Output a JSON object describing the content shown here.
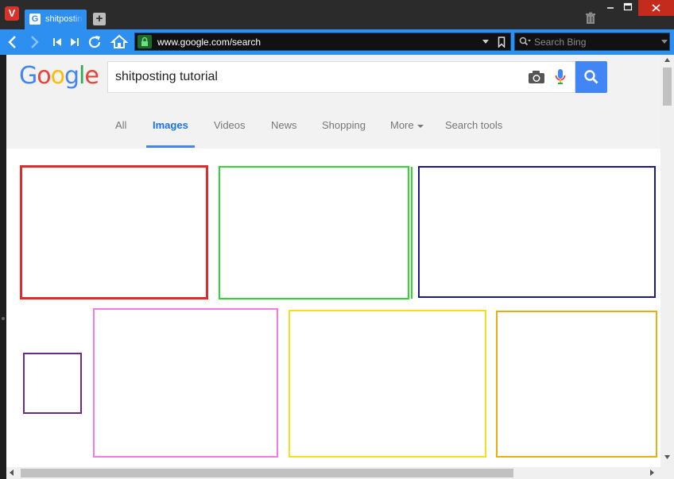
{
  "browser": {
    "tab": {
      "title": "shitposting tutorial",
      "favicon": "G"
    },
    "logo_letter": "V",
    "new_tab_glyph": "+",
    "address": {
      "url": "www.google.com/search"
    },
    "search": {
      "placeholder": "Search Bing"
    }
  },
  "google": {
    "logo": [
      {
        "ch": "G",
        "color": "#4285f4"
      },
      {
        "ch": "o",
        "color": "#ea4335"
      },
      {
        "ch": "o",
        "color": "#fbbc05"
      },
      {
        "ch": "g",
        "color": "#4285f4"
      },
      {
        "ch": "l",
        "color": "#34a853"
      },
      {
        "ch": "e",
        "color": "#ea4335"
      }
    ],
    "query": "shitposting tutorial",
    "tabs": [
      {
        "label": "All"
      },
      {
        "label": "Images",
        "active": true
      },
      {
        "label": "Videos"
      },
      {
        "label": "News"
      },
      {
        "label": "Shopping"
      },
      {
        "label": "More"
      },
      {
        "label": "Search tools"
      }
    ]
  },
  "image_results": [
    {
      "border_color": "#e12b2b"
    },
    {
      "border_color": "#2fd92f"
    },
    {
      "border_color": "#1a1a8c"
    },
    {
      "border_color": "#6a2c86"
    },
    {
      "border_color": "#f07ae8"
    },
    {
      "border_color": "#f2e21c"
    },
    {
      "border_color": "#e8ae12"
    }
  ],
  "colors": {
    "accent": "#2d8ff0",
    "google_blue": "#4285f4"
  }
}
